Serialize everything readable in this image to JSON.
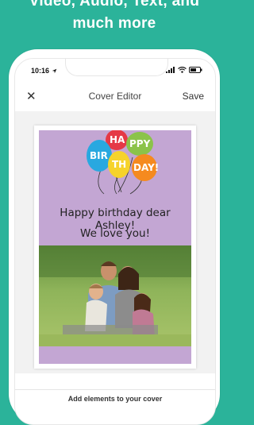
{
  "headline": {
    "line1": "Video, Audio, Text, and",
    "line2": "much more"
  },
  "status_bar": {
    "time": "10:16",
    "icons": [
      "location-arrow-icon",
      "signal-icon",
      "wifi-icon",
      "battery-icon"
    ]
  },
  "nav": {
    "close_icon": "close-icon",
    "title": "Cover Editor",
    "save_label": "Save"
  },
  "card": {
    "greeting": "Happy birthday dear Ashley!",
    "subline": "We love you!",
    "balloons": [
      {
        "letters": "HA",
        "color": "#e53946"
      },
      {
        "letters": "PPY",
        "color": "#8bc34a"
      },
      {
        "letters": "BIR",
        "color": "#29a8e0"
      },
      {
        "letters": "TH",
        "color": "#f6d32b"
      },
      {
        "letters": "DAY!",
        "color": "#f58a1f"
      }
    ],
    "background_color": "#c3a6d3",
    "photo": "family-photo"
  },
  "bottom": {
    "add_elements_label": "Add elements to your cover"
  },
  "colors": {
    "brand_background": "#2bb39a",
    "card_background": "#c3a6d3"
  }
}
